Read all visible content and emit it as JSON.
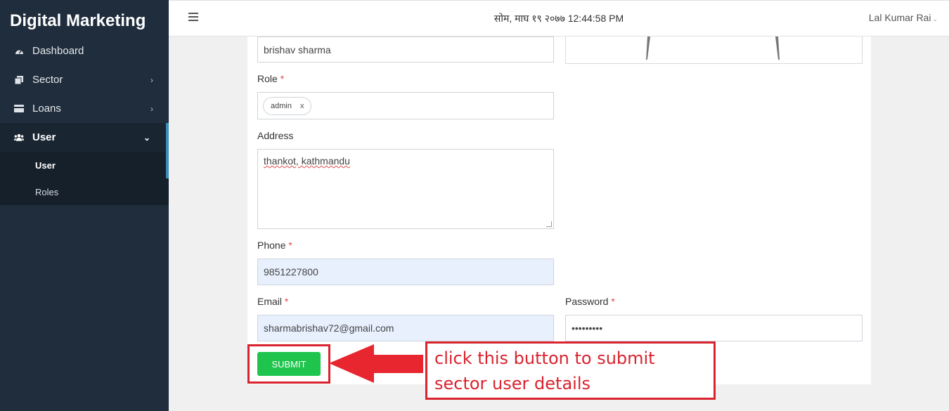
{
  "brand": "Digital Marketing",
  "sidebar": {
    "items": [
      {
        "label": "Dashboard",
        "icon": "dashboard-icon"
      },
      {
        "label": "Sector",
        "icon": "copy-icon"
      },
      {
        "label": "Loans",
        "icon": "card-icon"
      },
      {
        "label": "User",
        "icon": "users-icon"
      }
    ],
    "submenu": [
      {
        "label": "User"
      },
      {
        "label": "Roles"
      }
    ]
  },
  "topbar": {
    "datetime": "सोम, माघ १९ २०७७ 12:44:58 PM",
    "user": "Lal Kumar Rai"
  },
  "form": {
    "name_value": "brishav sharma",
    "role_label": "Role",
    "role_tag": "admin",
    "role_tag_remove": "x",
    "address_label": "Address",
    "address_value": "thankot, kathmandu",
    "phone_label": "Phone",
    "phone_value": "9851227800",
    "email_label": "Email",
    "email_value": "sharmabrishav72@gmail.com",
    "password_label": "Password",
    "password_value": "•••••••••",
    "required_mark": "*",
    "submit_label": "SUBMIT"
  },
  "annotation": {
    "text": "click this button to submit sector user details",
    "color": "#d9232e"
  },
  "colors": {
    "sidebar_bg": "#1f2d3d",
    "accent": "#3c8dbc",
    "submit_bg": "#1fc44c",
    "autofill_bg": "#e8f0fe"
  }
}
